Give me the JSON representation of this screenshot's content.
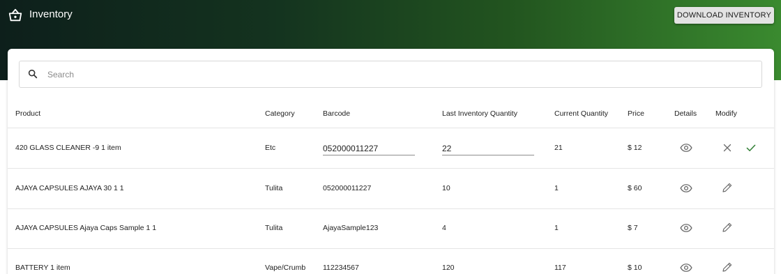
{
  "app": {
    "title": "Inventory",
    "logo_icon": "basket-icon",
    "download_label": "DOWNLOAD INVENTORY"
  },
  "search": {
    "placeholder": "Search",
    "value": "",
    "icon": "search-icon"
  },
  "table": {
    "headers": {
      "product": "Product",
      "category": "Category",
      "barcode": "Barcode",
      "last_qty": "Last Inventory Quantity",
      "current_qty": "Current Quantity",
      "price": "Price",
      "details": "Details",
      "modify": "Modify"
    },
    "editing_row": {
      "product": "420 GLASS CLEANER -9 1 item",
      "category": "Etc",
      "barcode": "052000011227",
      "last_qty": "22",
      "current_qty": "21",
      "price": "$ 12"
    },
    "rows": [
      {
        "product": "AJAYA CAPSULES AJAYA 30 1 1",
        "category": "Tulita",
        "barcode": "052000011227",
        "last_qty": "10",
        "current_qty": "1",
        "price": "$ 60"
      },
      {
        "product": "AJAYA CAPSULES Ajaya Caps Sample 1 1",
        "category": "Tulita",
        "barcode": "AjayaSample123",
        "last_qty": "4",
        "current_qty": "1",
        "price": "$ 7"
      },
      {
        "product": "BATTERY 1 item",
        "category": "Vape/Crumb",
        "barcode": "112234567",
        "last_qty": "120",
        "current_qty": "117",
        "price": "$ 10"
      }
    ]
  },
  "colors": {
    "header_dark": "#0d1f1b",
    "header_green": "#3a8a2f",
    "confirm_green": "#2e7d32",
    "icon_grey": "#6b6b6b"
  }
}
